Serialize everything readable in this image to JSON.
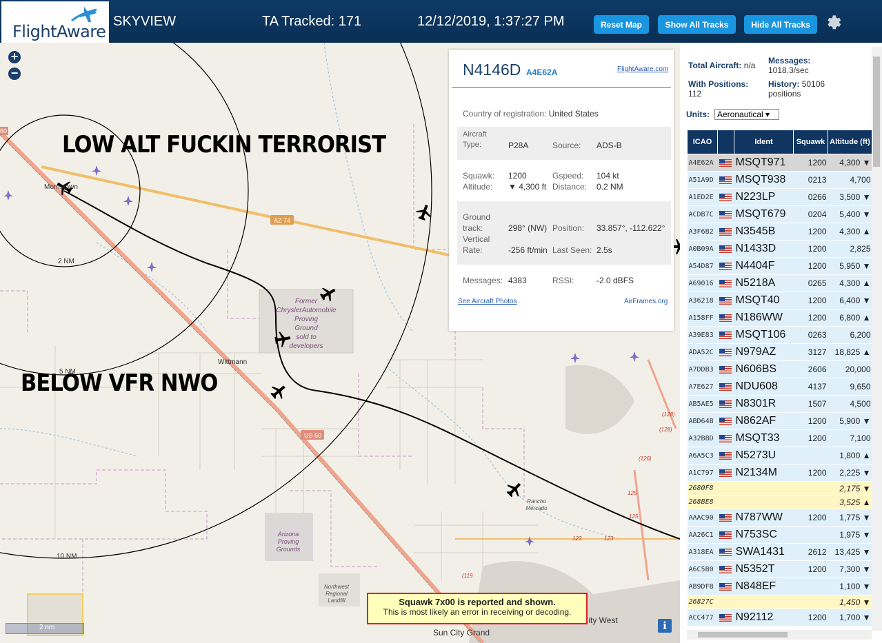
{
  "header": {
    "logo_text": "FlightAware",
    "app_name": "SKYVIEW",
    "ta_tracked": "TA Tracked: 171",
    "datetime": "12/12/2019, 1:37:27 PM",
    "reset_map": "Reset Map",
    "show_all": "Show All Tracks",
    "hide_all": "Hide All Tracks",
    "settings_icon": "gear-icon"
  },
  "map": {
    "zoom_in": "+",
    "zoom_out": "−",
    "overlay_top": "LOW ALT FUCKIN TERRORIST",
    "overlay_bottom": "BELOW VFR NWO",
    "labels": {
      "morristown": "Morristown",
      "wittmann": "Wittmann",
      "az74": "AZ 74",
      "us60": "US 60",
      "ring2": "2 NM",
      "ring5": "5 NM",
      "ring10": "10 NM",
      "chrysler": [
        "Former",
        "ChryslerAutomobile",
        "Proving",
        "Ground",
        "sold to",
        "developers"
      ],
      "arizona": [
        "Arizona",
        "Proving",
        "Grounds"
      ],
      "northwest": [
        "Northwest",
        "Regional",
        "Landfill"
      ],
      "rancho": [
        "Rancho",
        "Mercado"
      ],
      "suncitygrand": "Sun City Grand",
      "suncitywest": "Sun City West",
      "r60": "60",
      "r125a": "125",
      "r125b": "125",
      "r123a": "123",
      "r123b": "123",
      "r126": "(126)",
      "r128a": "(128)",
      "r128b": "(128)",
      "r119": "(119"
    },
    "scale": "2 nm",
    "info_icon": "i",
    "warning_line1": "Squawk 7x00 is reported and shown.",
    "warning_line2": "This is most likely an error in receiving or decoding."
  },
  "aircraft": {
    "ident": "N4146D",
    "icao": "A4E62A",
    "fa_link": "FlightAware.com",
    "country_label": "Country of registration:",
    "country": "United States",
    "type_label1": "Aircraft",
    "type_label2": "Type:",
    "type": "P28A",
    "source_label": "Source:",
    "source": "ADS-B",
    "squawk_label": "Squawk:",
    "squawk": "1200",
    "gspeed_label": "Gspeed:",
    "gspeed": "104 kt",
    "altitude_label": "Altitude:",
    "altitude": "▼ 4,300 ft",
    "distance_label": "Distance:",
    "distance": "0.2 NM",
    "track_label1": "Ground",
    "track_label2": "track:",
    "track": "298° (NW)",
    "position_label": "Position:",
    "position": "33.857°, -112.622°",
    "vrate_label1": "Vertical",
    "vrate_label2": "Rate:",
    "vrate": "-256 ft/min",
    "lastseen_label": "Last Seen:",
    "lastseen": "2.5s",
    "messages_label": "Messages:",
    "messages": "4383",
    "rssi_label": "RSSI:",
    "rssi": "-2.0 dBFS",
    "photos_link": "See Aircraft Photos",
    "airframes_link": "AirFrames.org"
  },
  "stats": {
    "total_label": "Total Aircraft:",
    "total": "n/a",
    "messages_label": "Messages:",
    "messages": "1018.3/sec",
    "positions_label": "With Positions:",
    "positions": "112",
    "history_label": "History:",
    "history": "50106",
    "history_unit": "positions",
    "units_label": "Units:",
    "units_value": "Aeronautical ▾"
  },
  "table": {
    "headers": [
      "ICAO",
      "",
      "Ident",
      "Squawk",
      "Altitude (ft)"
    ],
    "rows": [
      {
        "icao": "A4E62A",
        "ident": "MSQT971",
        "squawk": "1200",
        "alt": "4,300 ▼",
        "style": "sel"
      },
      {
        "icao": "A51A9D",
        "ident": "MSQT938",
        "squawk": "0213",
        "alt": "4,700",
        "style": "r"
      },
      {
        "icao": "A1ED2E",
        "ident": "N223LP",
        "squawk": "0266",
        "alt": "3,500 ▼",
        "style": "r"
      },
      {
        "icao": "ACDB7C",
        "ident": "MSQT679",
        "squawk": "0204",
        "alt": "5,400 ▼",
        "style": "r"
      },
      {
        "icao": "A3F6B2",
        "ident": "N3545B",
        "squawk": "1200",
        "alt": "4,300 ▲",
        "style": "r"
      },
      {
        "icao": "A0B09A",
        "ident": "N1433D",
        "squawk": "1200",
        "alt": "2,825",
        "style": "r"
      },
      {
        "icao": "A54D87",
        "ident": "N4404F",
        "squawk": "1200",
        "alt": "5,950 ▼",
        "style": "r"
      },
      {
        "icao": "A69016",
        "ident": "N5218A",
        "squawk": "0265",
        "alt": "4,300 ▲",
        "style": "r"
      },
      {
        "icao": "A36218",
        "ident": "MSQT40",
        "squawk": "1200",
        "alt": "6,400 ▼",
        "style": "r"
      },
      {
        "icao": "A158FF",
        "ident": "N186WW",
        "squawk": "1200",
        "alt": "6,800 ▲",
        "style": "r"
      },
      {
        "icao": "A39E83",
        "ident": "MSQT106",
        "squawk": "0263",
        "alt": "6,200",
        "style": "r"
      },
      {
        "icao": "ADA52C",
        "ident": "N979AZ",
        "squawk": "3127",
        "alt": "18,825 ▲",
        "style": "r"
      },
      {
        "icao": "A7DDB3",
        "ident": "N606BS",
        "squawk": "2606",
        "alt": "20,000",
        "style": "r"
      },
      {
        "icao": "A7E627",
        "ident": "NDU608",
        "squawk": "4137",
        "alt": "9,650",
        "style": "r"
      },
      {
        "icao": "AB5AE5",
        "ident": "N8301R",
        "squawk": "1507",
        "alt": "4,500",
        "style": "r"
      },
      {
        "icao": "ABD64B",
        "ident": "N862AF",
        "squawk": "1200",
        "alt": "5,900 ▼",
        "style": "r"
      },
      {
        "icao": "A32BBD",
        "ident": "MSQT33",
        "squawk": "1200",
        "alt": "7,100",
        "style": "r"
      },
      {
        "icao": "A6A5C3",
        "ident": "N5273U",
        "squawk": "",
        "alt": "1,800 ▲",
        "style": "r"
      },
      {
        "icao": "A1C797",
        "ident": "N2134M",
        "squawk": "1200",
        "alt": "2,225 ▼",
        "style": "r"
      },
      {
        "icao": "2680F8",
        "ident": "",
        "squawk": "",
        "alt": "2,175 ▼",
        "style": "y"
      },
      {
        "icao": "268BE8",
        "ident": "",
        "squawk": "",
        "alt": "3,525 ▲",
        "style": "y"
      },
      {
        "icao": "AAAC90",
        "ident": "N787WW",
        "squawk": "1200",
        "alt": "1,775 ▼",
        "style": "r"
      },
      {
        "icao": "AA26C1",
        "ident": "N753SC",
        "squawk": "",
        "alt": "1,975 ▼",
        "style": "r"
      },
      {
        "icao": "A318EA",
        "ident": "SWA1431",
        "squawk": "2612",
        "alt": "13,425 ▼",
        "style": "r"
      },
      {
        "icao": "A6C5B0",
        "ident": "N5352T",
        "squawk": "1200",
        "alt": "7,300 ▼",
        "style": "r"
      },
      {
        "icao": "AB9DFB",
        "ident": "N848EF",
        "squawk": "",
        "alt": "1,100 ▼",
        "style": "r"
      },
      {
        "icao": "26827C",
        "ident": "",
        "squawk": "",
        "alt": "1,450 ▼",
        "style": "y"
      },
      {
        "icao": "ACC477",
        "ident": "N92112",
        "squawk": "1200",
        "alt": "1,700 ▼",
        "style": "r"
      }
    ]
  },
  "colors": {
    "header_bg": "#0d3a66",
    "button_blue": "#1a96e0",
    "table_header": "#0f3560",
    "row_blue": "#dff0fb",
    "row_yellow": "#fff6c4"
  }
}
